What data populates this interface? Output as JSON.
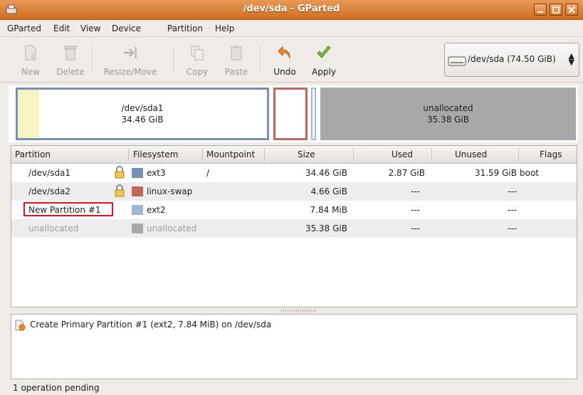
{
  "window": {
    "title": "/dev/sda - GParted"
  },
  "menu": [
    "GParted",
    "Edit",
    "View",
    "Device",
    "Partition",
    "Help"
  ],
  "toolbar": {
    "new": "New",
    "delete": "Delete",
    "resize": "Resize/Move",
    "copy": "Copy",
    "paste": "Paste",
    "undo": "Undo",
    "apply": "Apply"
  },
  "device": {
    "label": "/dev/sda  (74.50 GiB)"
  },
  "diskmap": {
    "sda1_name": "/dev/sda1",
    "sda1_size": "34.46 GiB",
    "unalloc_name": "unallocated",
    "unalloc_size": "35.38 GiB"
  },
  "columns": [
    "Partition",
    "Filesystem",
    "Mountpoint",
    "Size",
    "Used",
    "Unused",
    "Flags"
  ],
  "rows": [
    {
      "partition": "/dev/sda1",
      "filesystem": "ext3",
      "mountpoint": "/",
      "size": "34.46 GiB",
      "used": "2.87 GiB",
      "unused": "31.59 GiB",
      "flags": "boot",
      "color": "#7a8fb8"
    },
    {
      "partition": "/dev/sda2",
      "filesystem": "linux-swap",
      "mountpoint": "",
      "size": "4.66 GiB",
      "used": "---",
      "unused": "---",
      "flags": "",
      "color": "#c1665a"
    },
    {
      "partition": "New Partition #1",
      "filesystem": "ext2",
      "mountpoint": "",
      "size": "7.84 MiB",
      "used": "---",
      "unused": "---",
      "flags": "",
      "color": "#9db8d2"
    },
    {
      "partition": "unallocated",
      "filesystem": "unallocated",
      "mountpoint": "",
      "size": "35.38 GiB",
      "used": "---",
      "unused": "---",
      "flags": "",
      "color": "#a8a8a8"
    }
  ],
  "operations": [
    "Create Primary Partition #1 (ext2, 7.84 MiB) on /dev/sda"
  ],
  "status": "1 operation pending",
  "colors": {
    "titlebar": "#dd8640",
    "ext3": "#7a8fb8",
    "swap": "#c1665a",
    "ext2": "#9db8d2",
    "unallocated": "#a8a8a8",
    "highlight": "#e3141b"
  }
}
